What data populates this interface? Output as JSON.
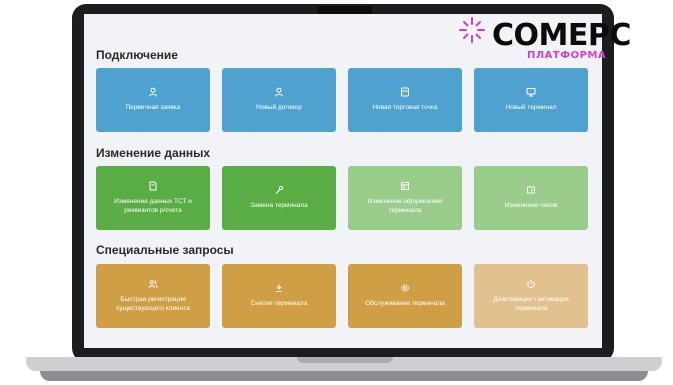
{
  "brand": {
    "name": "COMEPC",
    "subtitle": "ПЛАТФОРМА",
    "accent": "#d63ec0"
  },
  "sections": [
    {
      "title": "Подключение",
      "color": "#4fa2cf",
      "tiles": [
        {
          "label": "Первичная заявка",
          "icon": "user-icon"
        },
        {
          "label": "Новый договор",
          "icon": "user-icon"
        },
        {
          "label": "Новая торговая точка",
          "icon": "calculator-icon"
        },
        {
          "label": "Новый терминал",
          "icon": "monitor-icon"
        }
      ]
    },
    {
      "title": "Изменение данных",
      "color": "#5aad44",
      "tiles": [
        {
          "label": "Изменение данных ТСТ и реквизитов р/счета",
          "icon": "document-icon"
        },
        {
          "label": "Замена терминала",
          "icon": "wrench-icon"
        },
        {
          "label": "Изменение оформления терминала",
          "icon": "layout-icon"
        },
        {
          "label": "Изменение чеков",
          "icon": "receipt-icon"
        }
      ]
    },
    {
      "title": "Специальные запросы",
      "color": "#cf9f45",
      "tiles": [
        {
          "label": "Быстрая регистрация существующего клиента",
          "icon": "users-icon"
        },
        {
          "label": "Снятие терминала",
          "icon": "remove-icon"
        },
        {
          "label": "Обслуживание терминала",
          "icon": "gear-icon"
        },
        {
          "label": "Деактивация \\ активация терминала",
          "icon": "power-icon"
        }
      ]
    }
  ]
}
